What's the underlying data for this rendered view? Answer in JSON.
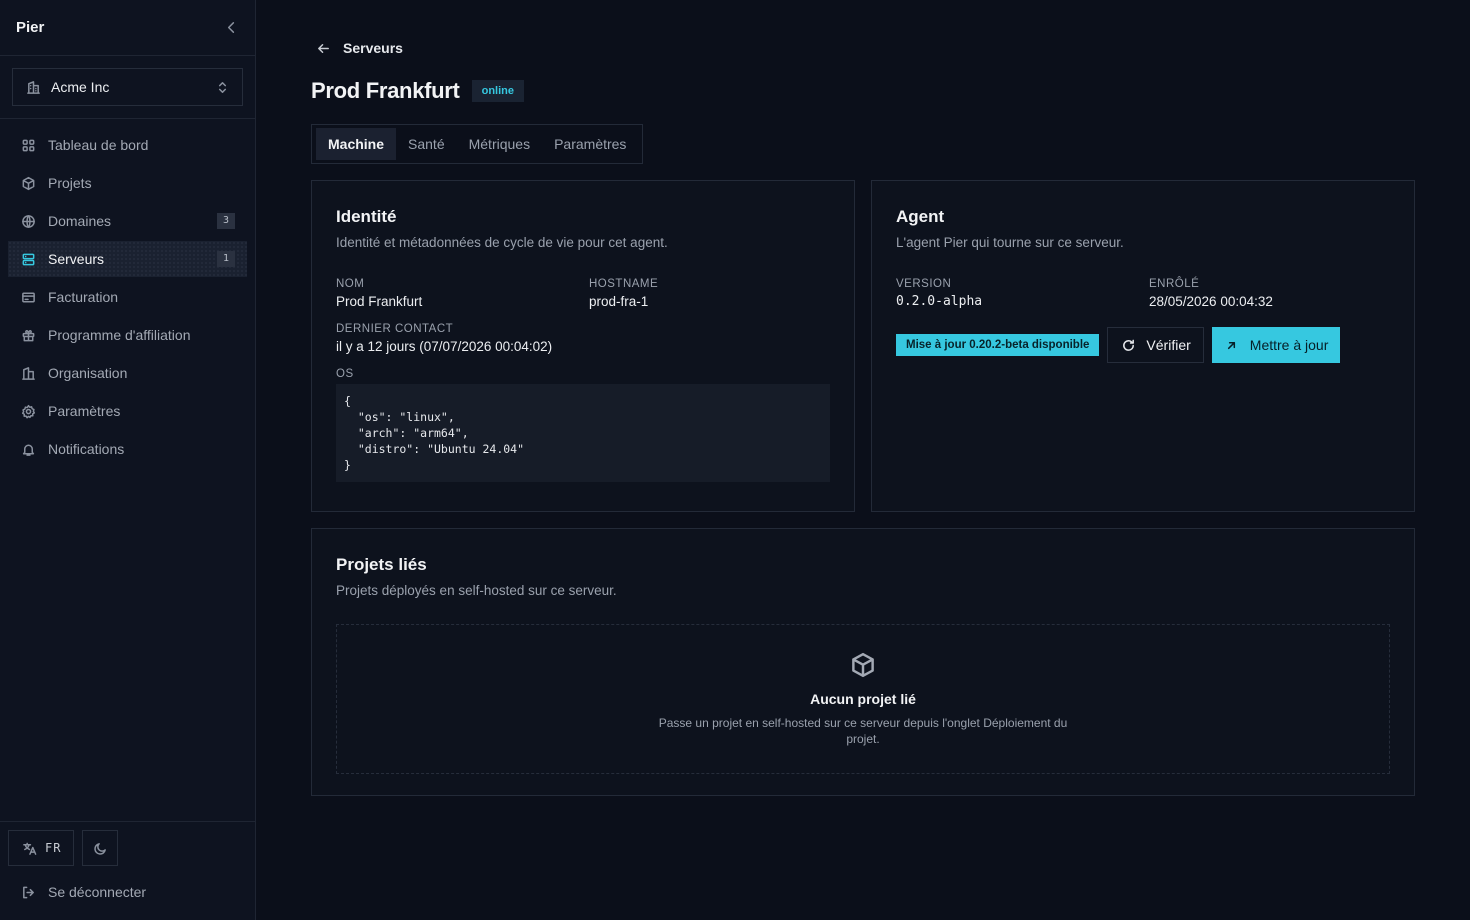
{
  "sidebar": {
    "brand": "Pier",
    "org_name": "Acme Inc",
    "items": [
      {
        "label": "Tableau de bord",
        "icon": "grid-icon"
      },
      {
        "label": "Projets",
        "icon": "box-icon"
      },
      {
        "label": "Domaines",
        "icon": "globe-icon",
        "count": "3"
      },
      {
        "label": "Serveurs",
        "icon": "server-icon",
        "count": "1",
        "active": true
      },
      {
        "label": "Facturation",
        "icon": "credit-card-icon"
      },
      {
        "label": "Programme d'affiliation",
        "icon": "gift-icon"
      },
      {
        "label": "Organisation",
        "icon": "building-icon"
      },
      {
        "label": "Paramètres",
        "icon": "gear-icon"
      },
      {
        "label": "Notifications",
        "icon": "bell-icon"
      }
    ],
    "language": "FR",
    "logout": "Se déconnecter"
  },
  "header": {
    "back_label": "Serveurs",
    "title": "Prod Frankfurt",
    "status": "online"
  },
  "tabs": [
    "Machine",
    "Santé",
    "Métriques",
    "Paramètres"
  ],
  "identity": {
    "title": "Identité",
    "description": "Identité et métadonnées de cycle de vie pour cet agent.",
    "name_label": "NOM",
    "name_value": "Prod Frankfurt",
    "hostname_label": "HOSTNAME",
    "hostname_value": "prod-fra-1",
    "last_contact_label": "DERNIER CONTACT",
    "last_contact_value": "il y a 12 jours (07/07/2026 00:04:02)",
    "os_label": "OS",
    "os_value": "{\n  \"os\": \"linux\",\n  \"arch\": \"arm64\",\n  \"distro\": \"Ubuntu 24.04\"\n}"
  },
  "agent": {
    "title": "Agent",
    "description": "L'agent Pier qui tourne sur ce serveur.",
    "version_label": "VERSION",
    "version_value": "0.2.0-alpha",
    "enrolled_label": "ENRÔLÉ",
    "enrolled_value": "28/05/2026 00:04:32",
    "update_badge": "Mise à jour 0.20.2-beta disponible",
    "verify_label": "Vérifier",
    "update_label": "Mettre à jour"
  },
  "projects": {
    "title": "Projets liés",
    "description": "Projets déployés en self-hosted sur ce serveur.",
    "empty_title": "Aucun projet lié",
    "empty_text": "Passe un projet en self-hosted sur ce serveur depuis l'onglet Déploiement du projet."
  },
  "colors": {
    "accent": "#36c8e0",
    "background": "#0b0f1a",
    "sidebar": "#0e1320"
  }
}
